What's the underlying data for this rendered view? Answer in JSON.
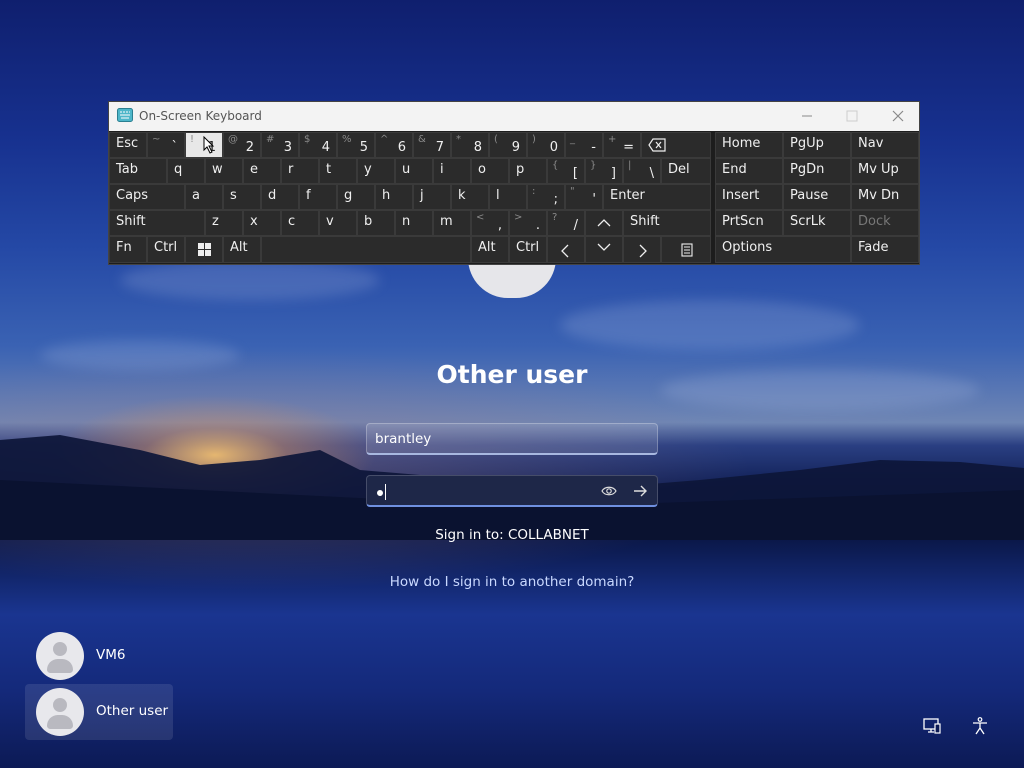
{
  "login": {
    "title": "Other user",
    "username_value": "brantley",
    "password_mask": "•",
    "sign_in_to": "Sign in to: COLLABNET",
    "other_domain_link": "How do I sign in to another domain?"
  },
  "users": [
    {
      "name": "VM6",
      "selected": false
    },
    {
      "name": "Other user",
      "selected": true
    }
  ],
  "corner_icons": [
    "network-icon",
    "accessibility-icon"
  ],
  "osk": {
    "title": "On-Screen Keyboard",
    "row1": [
      {
        "sym": "~",
        "main": "`"
      },
      {
        "sym": "!",
        "main": "1"
      },
      {
        "sym": "@",
        "main": "2"
      },
      {
        "sym": "#",
        "main": "3"
      },
      {
        "sym": "$",
        "main": "4"
      },
      {
        "sym": "%",
        "main": "5"
      },
      {
        "sym": "^",
        "main": "6"
      },
      {
        "sym": "&",
        "main": "7"
      },
      {
        "sym": "*",
        "main": "8"
      },
      {
        "sym": "(",
        "main": "9"
      },
      {
        "sym": ")",
        "main": "0"
      },
      {
        "sym": "_",
        "main": "-"
      },
      {
        "sym": "+",
        "main": "="
      }
    ],
    "labels": {
      "esc": "Esc",
      "tab": "Tab",
      "caps": "Caps",
      "shift": "Shift",
      "fn": "Fn",
      "ctrl": "Ctrl",
      "alt": "Alt",
      "del": "Del",
      "enter": "Enter",
      "home": "Home",
      "pgup": "PgUp",
      "nav": "Nav",
      "end": "End",
      "pgdn": "PgDn",
      "mvup": "Mv Up",
      "insert": "Insert",
      "pause": "Pause",
      "mvdn": "Mv Dn",
      "prtscn": "PrtScn",
      "scrlk": "ScrLk",
      "dock": "Dock",
      "options": "Options",
      "fade": "Fade"
    },
    "row2_letters": [
      "q",
      "w",
      "e",
      "r",
      "t",
      "y",
      "u",
      "i",
      "o",
      "p"
    ],
    "row2_sym": [
      {
        "sym": "{",
        "main": "["
      },
      {
        "sym": "}",
        "main": "]"
      },
      {
        "sym": "|",
        "main": "\\"
      }
    ],
    "row3_letters": [
      "a",
      "s",
      "d",
      "f",
      "g",
      "h",
      "j",
      "k",
      "l"
    ],
    "row3_sym": [
      {
        "sym": ":",
        "main": ";"
      },
      {
        "sym": "\"",
        "main": "'"
      }
    ],
    "row4_letters": [
      "z",
      "x",
      "c",
      "v",
      "b",
      "n",
      "m"
    ],
    "row4_sym": [
      {
        "sym": "<",
        "main": ","
      },
      {
        "sym": ">",
        "main": "."
      },
      {
        "sym": "?",
        "main": "/"
      }
    ]
  }
}
